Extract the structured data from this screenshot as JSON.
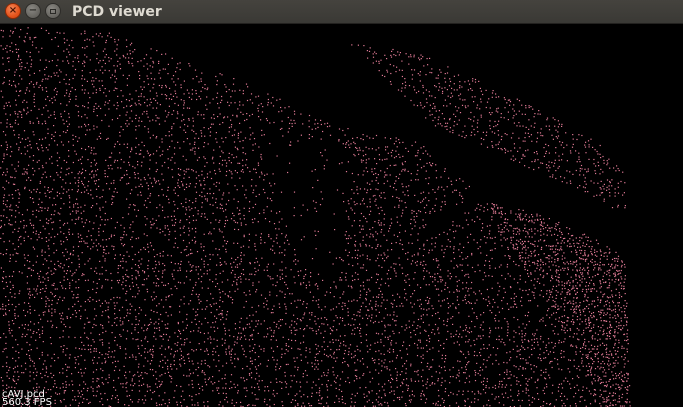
{
  "window": {
    "title": "PCD viewer",
    "buttons": {
      "close": "×",
      "minimize": "−",
      "maximize": "maximize-icon"
    }
  },
  "viewport": {
    "background_color": "#000000",
    "point_color": "#e07a95",
    "overlay": {
      "file_label": "cAVJ.pcd",
      "fps_label": "560.3 FPS"
    }
  }
}
